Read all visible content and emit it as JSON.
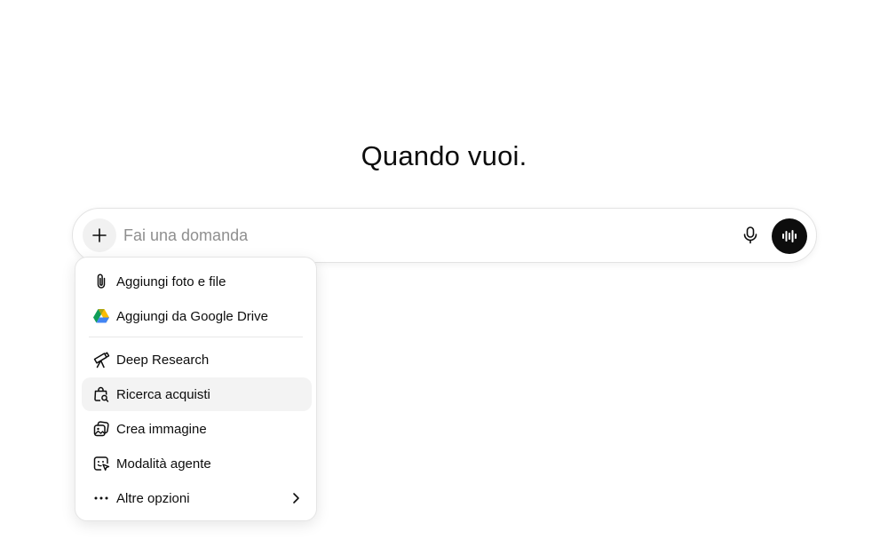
{
  "headline": "Quando vuoi.",
  "composer": {
    "placeholder": "Fai una domanda",
    "value": ""
  },
  "icons": {
    "plus": "plus-icon",
    "mic": "microphone-icon",
    "voice": "voice-waveform-icon"
  },
  "menu": {
    "items": [
      {
        "label": "Aggiungi foto e file",
        "icon": "paperclip-icon"
      },
      {
        "label": "Aggiungi da Google Drive",
        "icon": "google-drive-icon"
      },
      {
        "label": "Deep Research",
        "icon": "telescope-icon"
      },
      {
        "label": "Ricerca acquisti",
        "icon": "shopping-bag-search-icon"
      },
      {
        "label": "Crea immagine",
        "icon": "image-create-icon"
      },
      {
        "label": "Modalità agente",
        "icon": "agent-cursor-icon"
      },
      {
        "label": "Altre opzioni",
        "icon": "more-dots-icon"
      }
    ],
    "highlighted_index": 3
  },
  "colors": {
    "primary_text": "#0d0d0d",
    "placeholder_text": "#8f8f8f",
    "voice_button_bg": "#0d0d0d",
    "hover_bg": "#f3f3f3"
  }
}
